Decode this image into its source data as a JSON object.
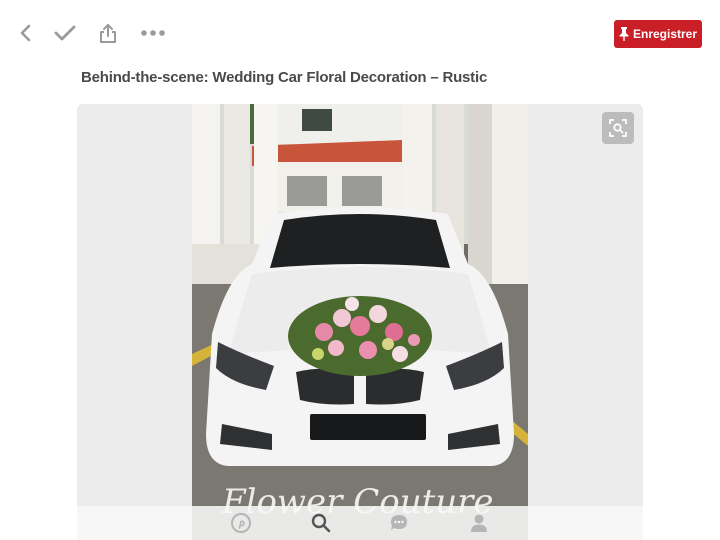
{
  "toolbar": {
    "back_icon": "chevron-left-icon",
    "done_icon": "checkmark-icon",
    "share_icon": "share-icon",
    "more_icon": "more-dots-icon",
    "save_label": "Enregistrer",
    "save_icon": "pushpin-icon",
    "accent": "#cb1f27"
  },
  "pin": {
    "title": "Behind-the-scene: Wedding Car Floral Decoration – Rustic",
    "image_watermark": "Flower Couture",
    "lens_icon": "visual-search-icon"
  },
  "bottom_nav": {
    "items": [
      {
        "icon": "pinterest-logo-icon"
      },
      {
        "icon": "search-icon"
      },
      {
        "icon": "chat-bubble-icon"
      },
      {
        "icon": "profile-icon"
      }
    ]
  }
}
